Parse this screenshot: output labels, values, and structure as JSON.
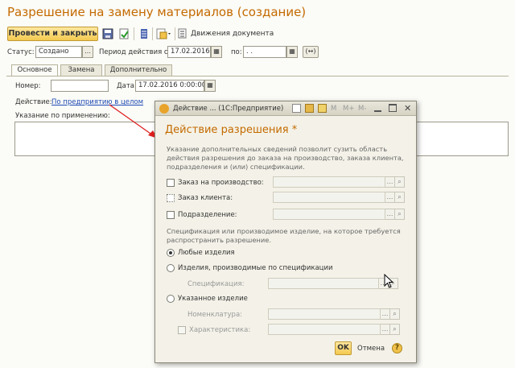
{
  "window": {
    "title": "Разрешение на замену материалов (создание)"
  },
  "toolbar": {
    "post_close_label": "Провести и закрыть",
    "movements_label": "Движения документа"
  },
  "header": {
    "status_label": "Статус:",
    "status_value": "Создано",
    "period_label": "Период действия с:",
    "period_from": "17.02.2016",
    "period_to_label": "по:",
    "period_to": " .  . ",
    "period_btn_label": "(↔)"
  },
  "tabs": [
    {
      "label": "Основное"
    },
    {
      "label": "Замена"
    },
    {
      "label": "Дополнительно"
    }
  ],
  "main": {
    "number_label": "Номер:",
    "number_value": "",
    "date_label": "Дата:",
    "date_value": "17.02.2016  0:00:00",
    "action_label": "Действие:",
    "action_link": "По предприятию в целом",
    "usage_label": "Указание по применению:"
  },
  "dialog": {
    "window_title": "Действие ... (1С:Предприятие)",
    "window_buttons": {
      "m": "M",
      "mplus": "M+",
      "mminus": "M-"
    },
    "heading": "Действие разрешения *",
    "hint_lines": [
      "Указание дополнительных сведений позволит сузить область",
      "действия разрешения до заказа на производство, заказа клиента,",
      "подразделения и (или) спецификации."
    ],
    "filters": [
      {
        "label": "Заказ на производство:"
      },
      {
        "label": "Заказ клиента:"
      },
      {
        "label": "Подразделение:"
      }
    ],
    "spec_hint_lines": [
      "Спецификация или производимое изделие, на которое требуется",
      "распространить разрешение."
    ],
    "radio_any": "Любые изделия",
    "radio_spec": "Изделия, производимые по спецификации",
    "spec_label": "Спецификация:",
    "radio_item": "Указанное изделие",
    "nomenclature_label": "Номенклатура:",
    "characteristic_label": "Характеристика:",
    "ok_label": "OK",
    "cancel_label": "Отмена",
    "help_label": "?"
  },
  "colors": {
    "accent_orange": "#c46a00",
    "button_yellow": "#f3c94f",
    "link_blue": "#1d49b4",
    "annotation_arrow": "#e02020"
  }
}
